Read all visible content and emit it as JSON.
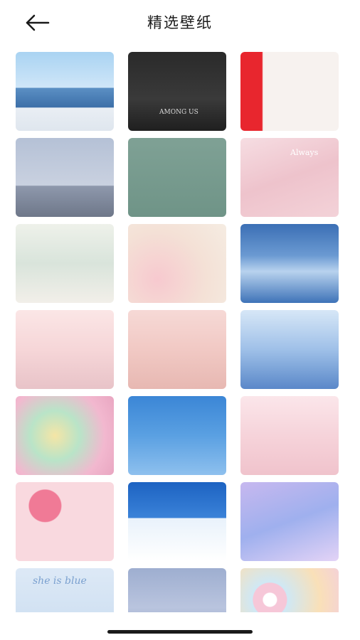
{
  "header": {
    "title": "精选壁纸",
    "back_icon": "arrow-left-icon"
  },
  "wallpapers": [
    {
      "name": "wallpaper-girls-seaside",
      "bg": "linear-gradient(180deg,#a9d3f2 0%,#cfe6f8 45%,#5b8fc4 46%,#3c6fa8 70%,#e9eef4 71%,#dfe6ee 100%)"
    },
    {
      "name": "wallpaper-among-us",
      "bg": "linear-gradient(180deg,#2a2a2a 0%,#3a3a3a 60%,#1f1f1f 100%)",
      "label": "AMONG US",
      "label_color": "#dddddd"
    },
    {
      "name": "wallpaper-legs-red",
      "bg": "linear-gradient(90deg,#e8262e 0%,#e8262e 22%,#f7f2ef 23%,#f7f2ef 100%)"
    },
    {
      "name": "wallpaper-boy-sky",
      "bg": "linear-gradient(180deg,#b5c1d6 0%,#c9d1e0 60%,#8e98ac 61%,#6e7789 100%)"
    },
    {
      "name": "wallpaper-shoes-green",
      "bg": "linear-gradient(180deg,#7fa195 0%,#6f9487 100%)"
    },
    {
      "name": "wallpaper-cherry-blossom",
      "bg": "linear-gradient(160deg,#f6dde2 0%,#eec3cc 50%,#f3d2d8 100%)",
      "label": "Always",
      "label_color": "#ffffff"
    },
    {
      "name": "wallpaper-dragon-girl",
      "bg": "linear-gradient(180deg,#eef1ea 0%,#d9e4db 50%,#f2efe9 100%)"
    },
    {
      "name": "wallpaper-ferris-wheel",
      "bg": "radial-gradient(circle at 30% 70%,#f7c9cf 0%,#f4e1d6 55%,#f5ece2 100%)"
    },
    {
      "name": "wallpaper-blue-clouds",
      "bg": "linear-gradient(180deg,#3b6fb5 0%,#6b9ad2 40%,#b8d2ee 60%,#3e73b8 100%)"
    },
    {
      "name": "wallpaper-pink-castle",
      "bg": "linear-gradient(180deg,#fbe6e6 0%,#f6d6d8 50%,#e8c3c8 100%)"
    },
    {
      "name": "wallpaper-manga-girl",
      "bg": "linear-gradient(180deg,#f6d9d6 0%,#f1c9c4 50%,#e7b8b2 100%)"
    },
    {
      "name": "wallpaper-couple-blue",
      "bg": "linear-gradient(180deg,#d7e7f7 0%,#9fc0e8 50%,#5a88c9 100%)"
    },
    {
      "name": "wallpaper-marshmallows",
      "bg": "radial-gradient(circle at 40% 50%,#f5e5a6 0%,#b9e4c8 35%,#f2b8cf 70%,#e9a6c1 100%)"
    },
    {
      "name": "wallpaper-cloud-blue",
      "bg": "linear-gradient(180deg,#3b86d6 0%,#5aa0e2 50%,#8ec0ee 100%)"
    },
    {
      "name": "wallpaper-couple-pink",
      "bg": "linear-gradient(180deg,#fbe6ea 0%,#f6d3da 50%,#f0c3cc 100%)"
    },
    {
      "name": "wallpaper-watermelon",
      "bg": "radial-gradient(circle at 30% 30%,#f07a96 0%,#f07a96 18%,#f9d9df 19%,#f9d9df 100%)"
    },
    {
      "name": "wallpaper-blue-calendar",
      "bg": "linear-gradient(180deg,#1d63c2 0%,#3a82d8 45%,#e9f2fb 46%,#ffffff 100%)"
    },
    {
      "name": "wallpaper-jellyfish",
      "bg": "linear-gradient(160deg,#c7b8ef 0%,#9fb0ee 50%,#e3d3f6 100%)"
    },
    {
      "name": "wallpaper-she-is-blue",
      "bg": "linear-gradient(180deg,#dde9f6 0%,#c9dcf0 100%)",
      "label": "she is blue",
      "label_color": "#7aa0cf"
    },
    {
      "name": "wallpaper-water-ripple",
      "bg": "linear-gradient(180deg,#9eaed0 0%,#b9c4de 50%,#8c9cc2 100%)"
    },
    {
      "name": "wallpaper-donuts",
      "bg": "radial-gradient(circle at 30% 40%,#ffffff 0%,#ffffff 8%,#f6c7d8 9%,#f6c7d8 20%,#cfe8f5 21%,#f9e0b8 60%,#f3cde0 100%)"
    }
  ]
}
